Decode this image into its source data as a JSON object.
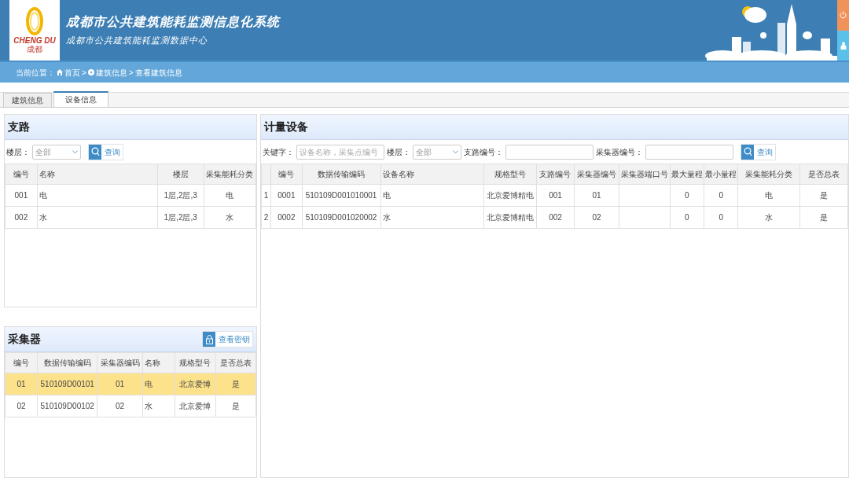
{
  "header": {
    "logo_text": "CHENG DU",
    "logo_subtext": "成都",
    "title": "成都市公共建筑能耗监测信息化系统",
    "subtitle": "成都市公共建筑能耗监测数据中心"
  },
  "breadcrumb": {
    "label": "当前位置：",
    "separator": ">",
    "items": [
      {
        "text": "首页"
      },
      {
        "text": "建筑信息"
      },
      {
        "text": "查看建筑信息"
      }
    ]
  },
  "tabs": [
    {
      "label": "建筑信息",
      "selected": false
    },
    {
      "label": "设备信息",
      "selected": true
    }
  ],
  "branch_panel": {
    "title": "支路",
    "filter_label": "楼层：",
    "filter_value": "全部",
    "search_button": "查询",
    "columns": [
      "编号",
      "名称",
      "楼层",
      "采集能耗分类"
    ],
    "rows": [
      [
        "001",
        "电",
        "1层,2层,3",
        "电"
      ],
      [
        "002",
        "水",
        "1层,2层,3",
        "水"
      ]
    ]
  },
  "collector_panel": {
    "title": "采集器",
    "key_button": "查看密钥",
    "columns": [
      "编号",
      "数据传输编码",
      "采集器编码",
      "名称",
      "规格型号",
      "是否总表"
    ],
    "rows": [
      {
        "selected": true,
        "cells": [
          "01",
          "510109D00101",
          "01",
          "电",
          "北京爱博",
          "是"
        ]
      },
      {
        "selected": false,
        "cells": [
          "02",
          "510109D00102",
          "02",
          "水",
          "北京爱博",
          "是"
        ]
      }
    ]
  },
  "meter_panel": {
    "title": "计量设备",
    "filters": [
      {
        "kind": "text",
        "label": "关键字：",
        "placeholder": "设备名称，采集点编号"
      },
      {
        "kind": "select",
        "label": "楼层：",
        "value": "全部"
      },
      {
        "kind": "text",
        "label": "支路编号："
      },
      {
        "kind": "text",
        "label": "采集器编号："
      }
    ],
    "search_button": "查询",
    "columns": [
      "编号",
      "数据传输编码",
      "设备名称",
      "规格型号",
      "支路编号",
      "采集器编号",
      "采集器端口号",
      "最大量程",
      "最小量程",
      "采集能耗分类",
      "是否总表"
    ],
    "rows": [
      {
        "index": "1",
        "cells": [
          "0001",
          "510109D001010001",
          "电",
          "北京爱博精电",
          "001",
          "01",
          null,
          "0",
          "0",
          "电",
          "是"
        ]
      },
      {
        "index": "2",
        "cells": [
          "0002",
          "510109D001020002",
          "水",
          "北京爱博精电",
          "002",
          "02",
          null,
          "0",
          "0",
          "水",
          "是"
        ]
      }
    ]
  }
}
